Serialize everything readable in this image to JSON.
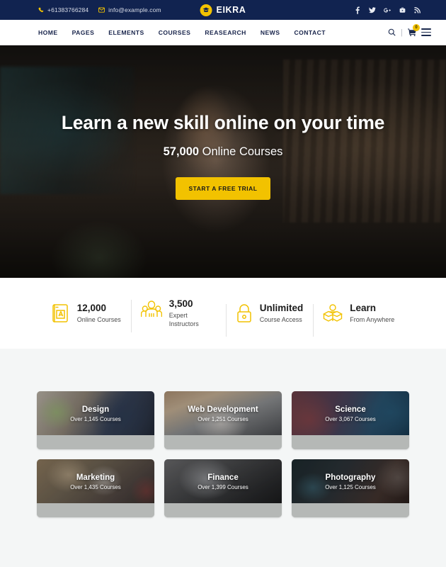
{
  "topbar": {
    "phone": "+61383766284",
    "email": "info@example.com",
    "phone_icon": "phone-icon",
    "email_icon": "envelope-icon",
    "brand_name": "EIKRA",
    "brand_icon": "graduation-cap-icon",
    "brand_color": "#f2c200",
    "background_color": "#112350",
    "socials": [
      {
        "name": "facebook-icon",
        "glyph": "f"
      },
      {
        "name": "twitter-icon",
        "glyph": "t"
      },
      {
        "name": "google-plus-icon",
        "glyph": "G+"
      },
      {
        "name": "youtube-icon",
        "glyph": "y"
      },
      {
        "name": "rss-icon",
        "glyph": "rss"
      }
    ]
  },
  "nav": {
    "links": [
      {
        "label": "HOME"
      },
      {
        "label": "PAGES"
      },
      {
        "label": "ELEMENTS"
      },
      {
        "label": "COURSES"
      },
      {
        "label": "REASEARCH"
      },
      {
        "label": "NEWS"
      },
      {
        "label": "CONTACT"
      }
    ],
    "separator": "|",
    "search_icon": "search-icon",
    "cart_icon": "shopping-cart-icon",
    "cart_count": "0",
    "menu_icon": "hamburger-menu-icon"
  },
  "hero": {
    "title": "Learn a new skill online on your time",
    "sub_number": "57,000",
    "sub_text": " Online Courses",
    "cta_label": "START A FREE TRIAL",
    "cta_color": "#f2c200"
  },
  "stats": [
    {
      "icon": "book-icon",
      "number": "12,000",
      "label": "Online Courses"
    },
    {
      "icon": "instructors-group-icon",
      "number": "3,500",
      "label": "Expert Instructors"
    },
    {
      "icon": "padlock-icon",
      "number": "Unlimited",
      "label": "Course Access"
    },
    {
      "icon": "person-reading-book-icon",
      "number": "Learn",
      "label": "From Anywhere"
    }
  ],
  "categories": [
    {
      "title": "Design",
      "count": "Over 1,145 Courses",
      "img": "img-design"
    },
    {
      "title": "Web Development",
      "count": "Over 1,251 Courses",
      "img": "img-web"
    },
    {
      "title": "Science",
      "count": "Over 3,067 Courses",
      "img": "img-science"
    },
    {
      "title": "Marketing",
      "count": "Over 1,435 Courses",
      "img": "img-marketing"
    },
    {
      "title": "Finance",
      "count": "Over 1,399 Courses",
      "img": "img-finance"
    },
    {
      "title": "Photography",
      "count": "Over 1,125 Courses",
      "img": "img-photography"
    }
  ]
}
